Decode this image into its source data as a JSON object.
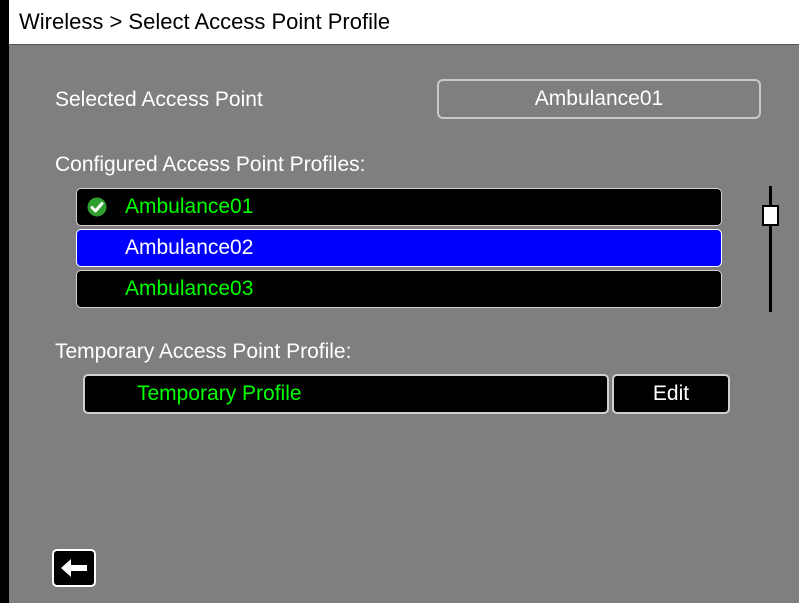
{
  "header": {
    "title": "Wireless > Select Access Point Profile"
  },
  "selected_access_point": {
    "label": "Selected Access Point",
    "value": "Ambulance01"
  },
  "profiles": {
    "heading": "Configured Access Point Profiles:",
    "items": [
      {
        "label": "Ambulance01",
        "active": true,
        "highlighted": false
      },
      {
        "label": "Ambulance02",
        "active": false,
        "highlighted": true
      },
      {
        "label": "Ambulance03",
        "active": false,
        "highlighted": false
      }
    ]
  },
  "temporary": {
    "heading": "Temporary Access Point Profile:",
    "profile_label": "Temporary Profile",
    "edit_label": "Edit"
  },
  "footer": {
    "back_icon": "back-arrow-icon"
  },
  "colors": {
    "background": "#7f7f7f",
    "highlight": "#0000ff",
    "profile_text": "#00ff00",
    "check": "#2e9e2e"
  }
}
